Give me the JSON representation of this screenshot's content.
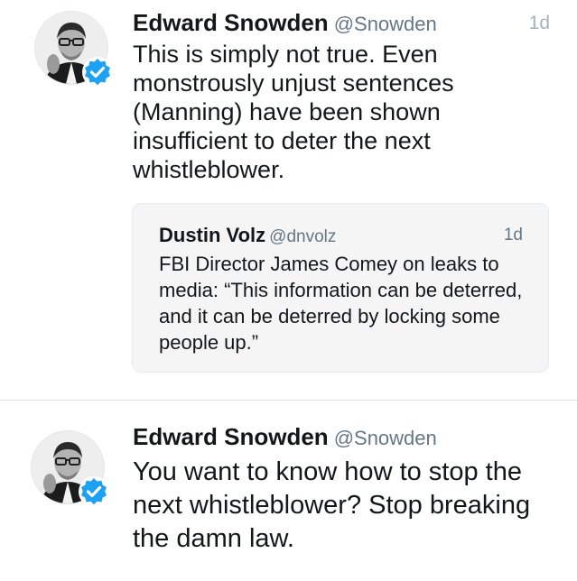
{
  "tweets": [
    {
      "display_name": "Edward Snowden",
      "handle": "@Snowden",
      "time": "1d",
      "text": "This is simply not true. Even monstrously unjust sentences (Manning) have been shown insufficient to deter the next whistleblower.",
      "avatar_icon": "profile-photo",
      "verified_icon": "verified-badge-icon",
      "quote": {
        "display_name": "Dustin Volz",
        "handle": "@dnvolz",
        "time": "1d",
        "text": "FBI Director James Comey on leaks to media: “This information can be deterred, and it can be deterred by locking some people up.”"
      }
    },
    {
      "display_name": "Edward Snowden",
      "handle": "@Snowden",
      "text": "You want to know how to stop the next whistleblower? Stop breaking the damn law.",
      "avatar_icon": "profile-photo",
      "verified_icon": "verified-badge-icon"
    }
  ],
  "colors": {
    "verified_blue": "#1da1f2",
    "name_text": "#14171a",
    "secondary_text": "#657786",
    "quote_background": "#f5f5f5"
  }
}
